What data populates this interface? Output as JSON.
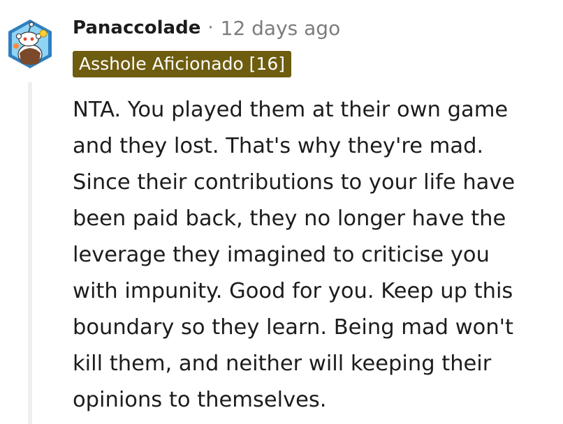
{
  "comment": {
    "username": "Panaccolade",
    "separator": "·",
    "timestamp": "12 days ago",
    "flair": "Asshole Aficionado [16]",
    "body_lines": [
      "NTA. You played them at their own game",
      "and they lost. That's why they're mad.",
      "Since their contributions to your life have",
      "been paid back, they no longer have the",
      "leverage they imagined to criticise you",
      "with impunity. Good for you. Keep up this",
      "boundary so they learn. Being mad won't",
      "kill them, and neither will keeping their",
      "opinions to themselves."
    ],
    "avatar_icon": "snoo-avatar-icon"
  },
  "colors": {
    "flair_bg": "#6e5c0f",
    "text": "#1c1c1c",
    "meta": "#7c7c7c",
    "thread_line": "#edeff1"
  }
}
